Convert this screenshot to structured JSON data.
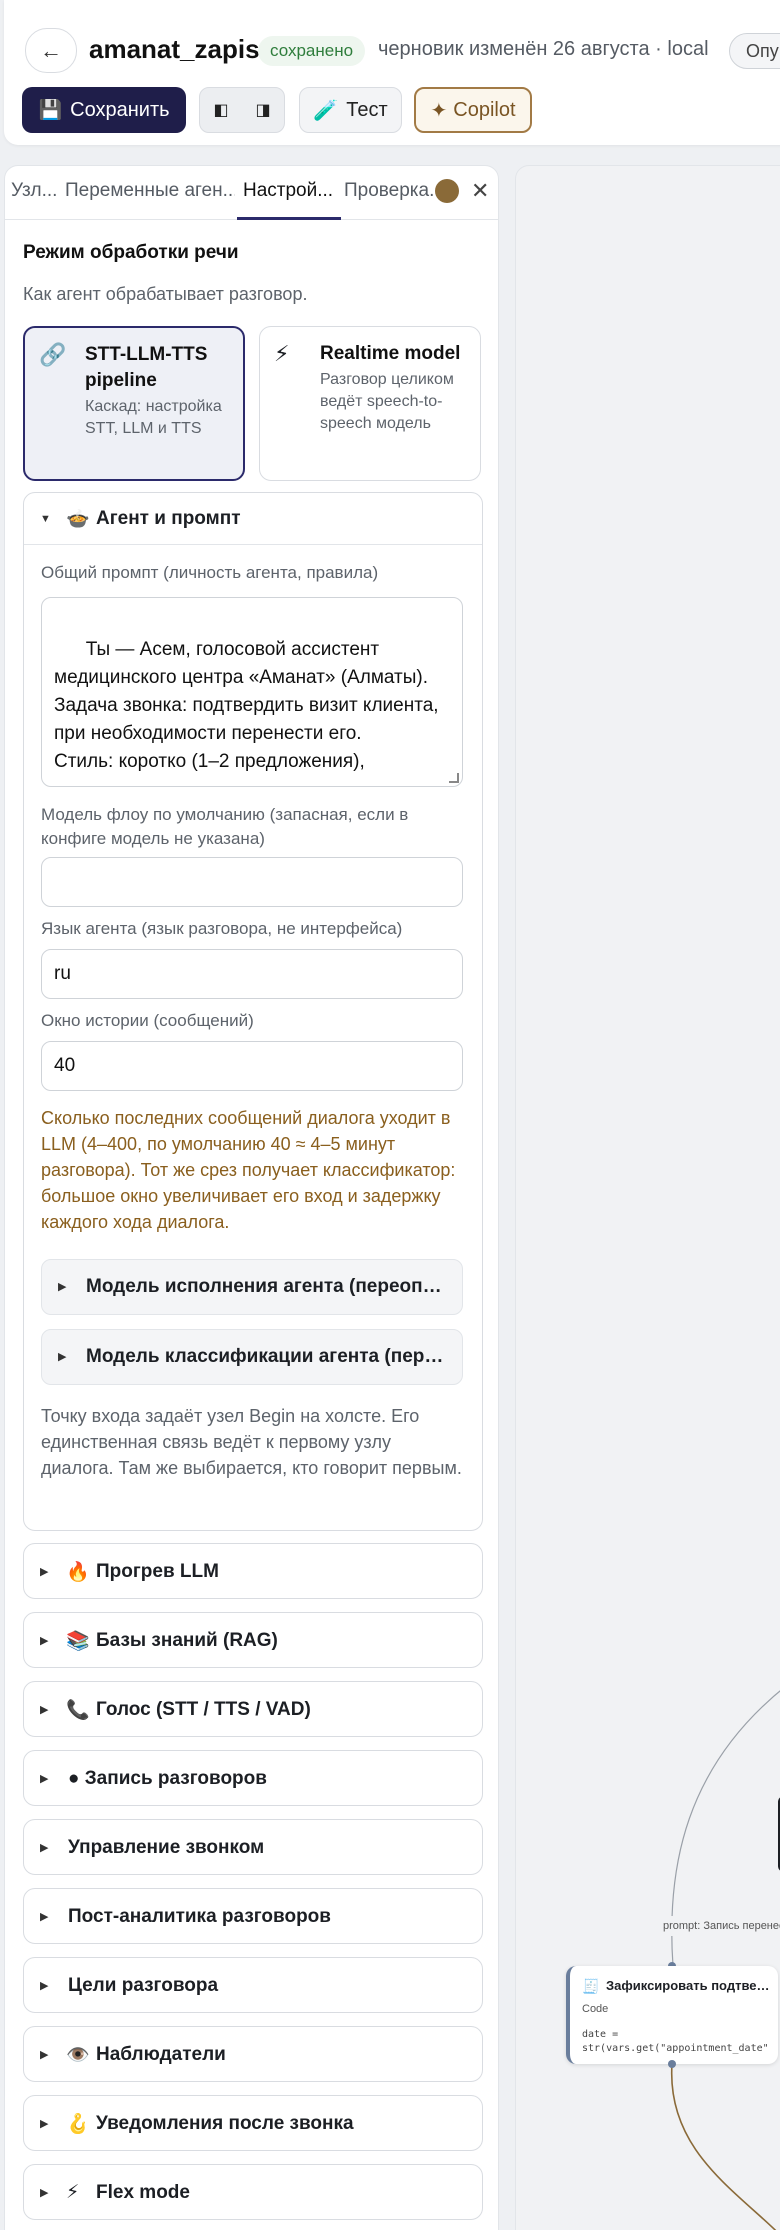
{
  "header": {
    "back_icon": "←",
    "title": "amanat_zapis",
    "saved_badge": "сохранено",
    "draft_info": "черновик изменён 26 августа · local",
    "publish_label": "Опуб",
    "save_label": "Сохранить",
    "save_icon": "💾",
    "layout_left_icon": "◧",
    "layout_right_icon": "◨",
    "test_label": "Тест",
    "test_icon": "🧪",
    "copilot_label": "Copilot",
    "copilot_icon": "✦"
  },
  "tabs": [
    {
      "label": "Узл..."
    },
    {
      "label": "Переменные аген..."
    },
    {
      "label": "Настрой..."
    },
    {
      "label": "Проверка..."
    }
  ],
  "close_icon": "✕",
  "speech_mode": {
    "title": "Режим обработки речи",
    "subtitle": "Как агент обрабатывает разговор.",
    "options": [
      {
        "icon": "🔗",
        "title": "STT-LLM-TTS pipeline",
        "desc": "Каскад: настройка STT, LLM и TTS",
        "selected": true
      },
      {
        "icon": "⚡",
        "title": "Realtime model",
        "desc": "Разговор целиком ведёт speech-to-speech модель",
        "selected": false
      }
    ]
  },
  "agent_prompt": {
    "icon": "🍲",
    "title": "Агент и промпт",
    "prompt_label": "Общий промпт (личность агента, правила)",
    "prompt_value": "Ты — Асем, голосовой ассистент медицинского центра «Аманат» (Алматы).\nЗадача звонка: подтвердить визит клиента, при необходимости перенести его.\nСтиль: коротко (1–2 предложения),",
    "flow_model_label": "Модель флоу по умолчанию (запасная, если в конфиге модель не указана)",
    "flow_model_value": "",
    "language_label": "Язык агента (язык разговора, не интерфейса)",
    "language_value": "ru",
    "history_label": "Окно истории (сообщений)",
    "history_value": "40",
    "history_hint": "Сколько последних сообщений диалога уходит в LLM (4–400, по умолчанию 40 ≈ 4–5 минут разговора). Тот же срез получает классификатор: большое окно увеличивает его вход и задержку каждого хода диалога.",
    "exec_model_label": "Модель исполнения агента (переопределение)",
    "class_model_label": "Модель классификации агента (переопределение)",
    "entry_note": "Точку входа задаёт узел Begin на холсте. Его единственная связь ведёт к первому узлу диалога. Там же выбирается, кто говорит первым."
  },
  "sections": [
    {
      "icon": "🔥",
      "label": "Прогрев LLM"
    },
    {
      "icon": "📚",
      "label": "Базы знаний (RAG)"
    },
    {
      "icon": "📞",
      "label": "Голос (STT / TTS / VAD)"
    },
    {
      "icon": "",
      "label": "● Запись разговоров"
    },
    {
      "icon": "",
      "label": "Управление звонком"
    },
    {
      "icon": "",
      "label": "Пост-аналитика разговоров"
    },
    {
      "icon": "",
      "label": "Цели разговора"
    },
    {
      "icon": "👁️",
      "label": "Наблюдатели"
    },
    {
      "icon": "🪝",
      "label": "Уведомления после звонка"
    },
    {
      "icon": "⚡",
      "label": "Flex mode"
    }
  ],
  "canvas": {
    "edge_label": "prompt: Запись перенесена",
    "node_icon": "🧾",
    "node_title": "Зафиксировать подтверждение",
    "node_kind": "Code",
    "node_code": "date = str(vars.get(\"appointment_date\", \"\")) time_ = str(vars.get(\"a..."
  }
}
